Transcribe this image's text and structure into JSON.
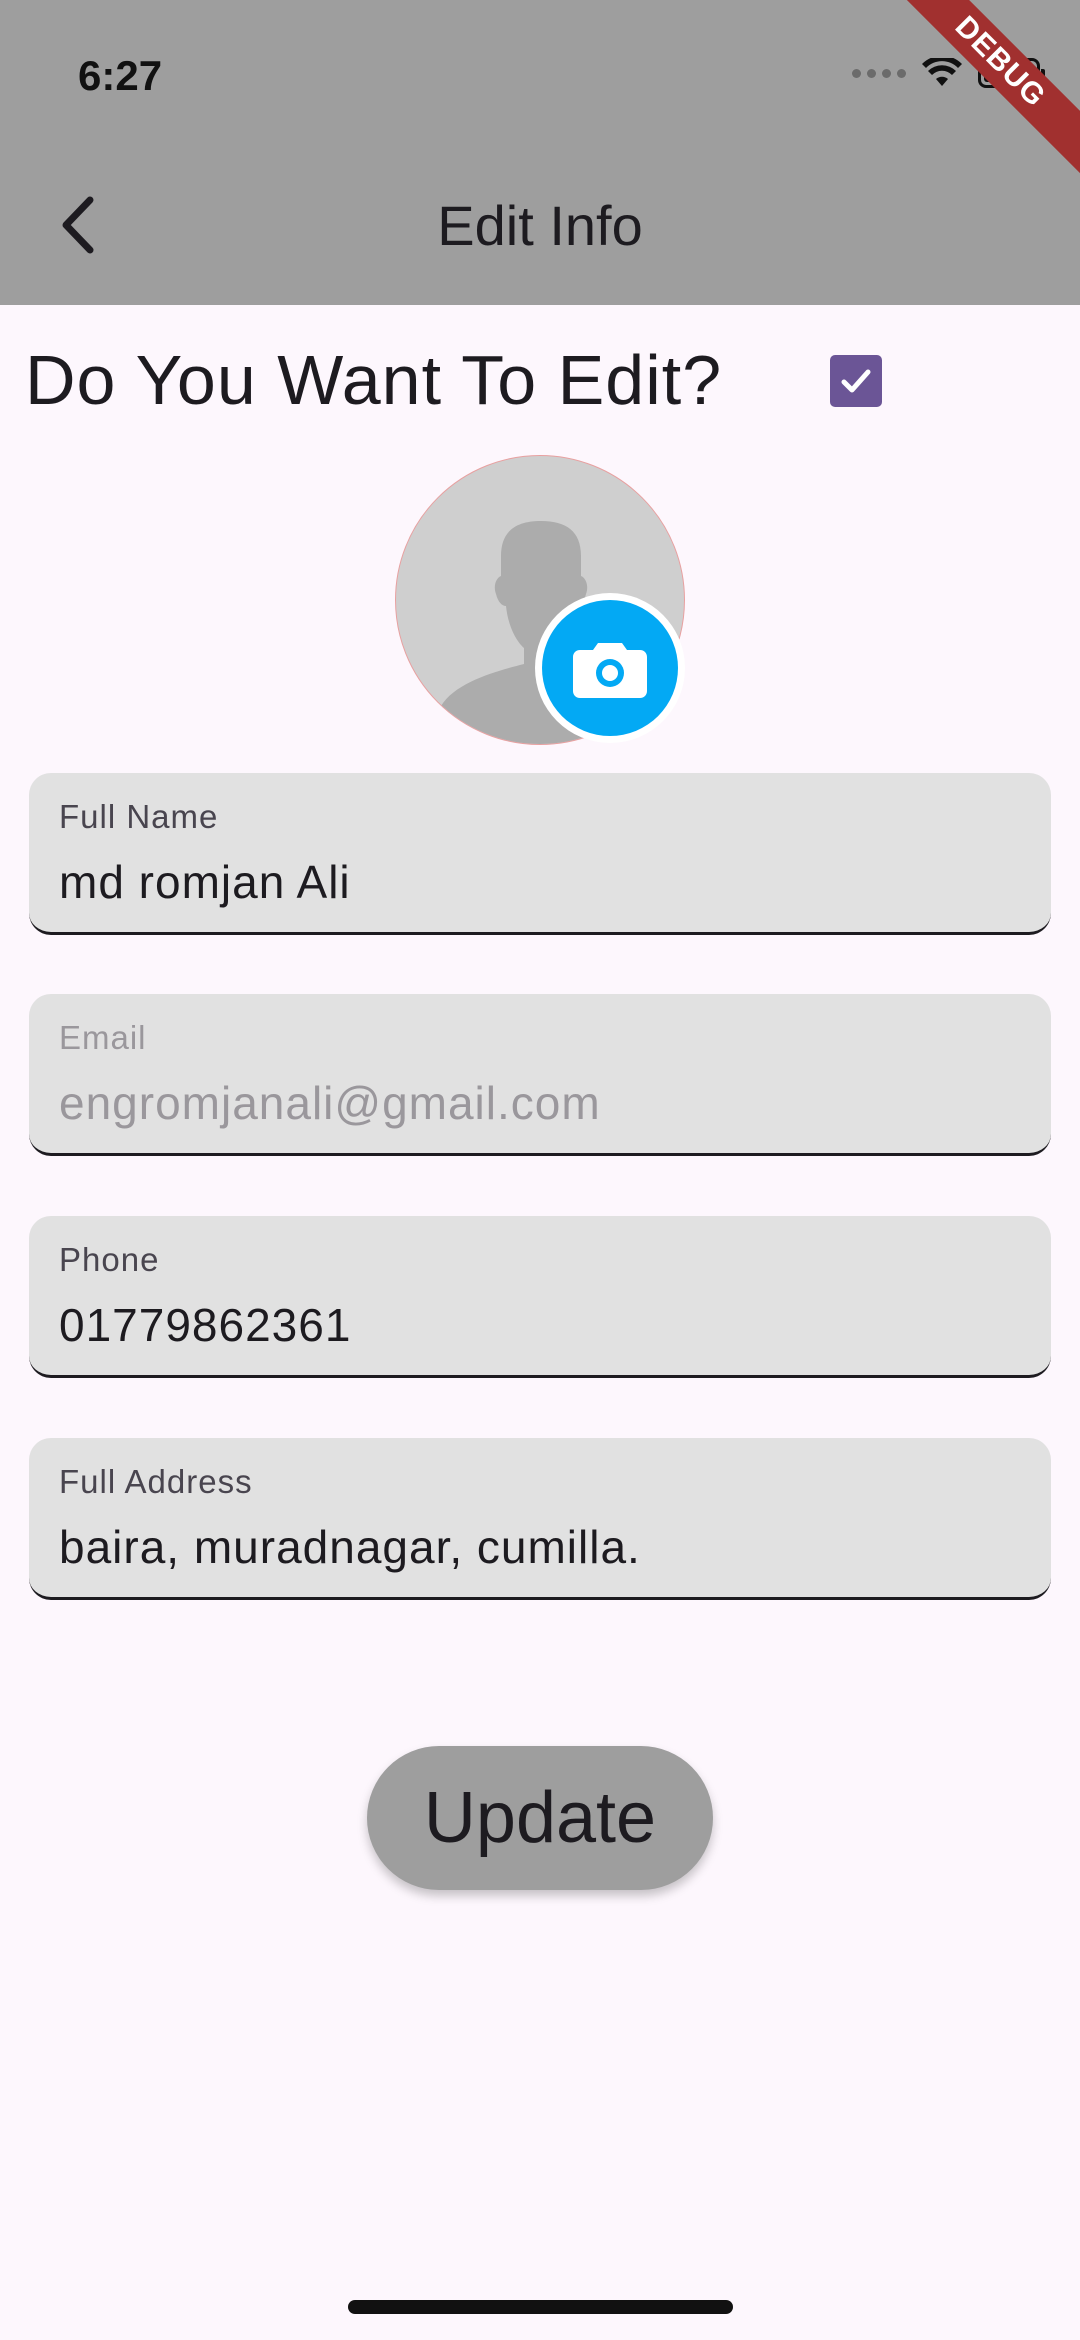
{
  "status_bar": {
    "time": "6:27",
    "icons": [
      "signal-dots-icon",
      "wifi-icon",
      "battery-icon"
    ]
  },
  "debug_banner": "DEBUG",
  "app_bar": {
    "back_icon": "chevron-left-icon",
    "title": "Edit Info"
  },
  "edit_toggle": {
    "label": "Do You Want To Edit?",
    "checked": true,
    "check_color": "#6b5596"
  },
  "avatar": {
    "icon": "person-placeholder-icon",
    "camera_icon": "camera-icon",
    "camera_color": "#03a9f4"
  },
  "form": {
    "fields": [
      {
        "label": "Full Name",
        "value": "md romjan Ali",
        "enabled": true
      },
      {
        "label": "Email",
        "value": "engromjanali@gmail.com",
        "enabled": false
      },
      {
        "label": "Phone",
        "value": "01779862361",
        "enabled": true
      },
      {
        "label": "Full Address",
        "value": "baira, muradnagar, cumilla.",
        "enabled": true
      }
    ]
  },
  "update_button": {
    "label": "Update"
  },
  "colors": {
    "app_bar": "#9e9e9e",
    "background": "#fdf7fd",
    "field_fill": "#e1e1e1",
    "debug_ribbon": "#a1302f"
  }
}
